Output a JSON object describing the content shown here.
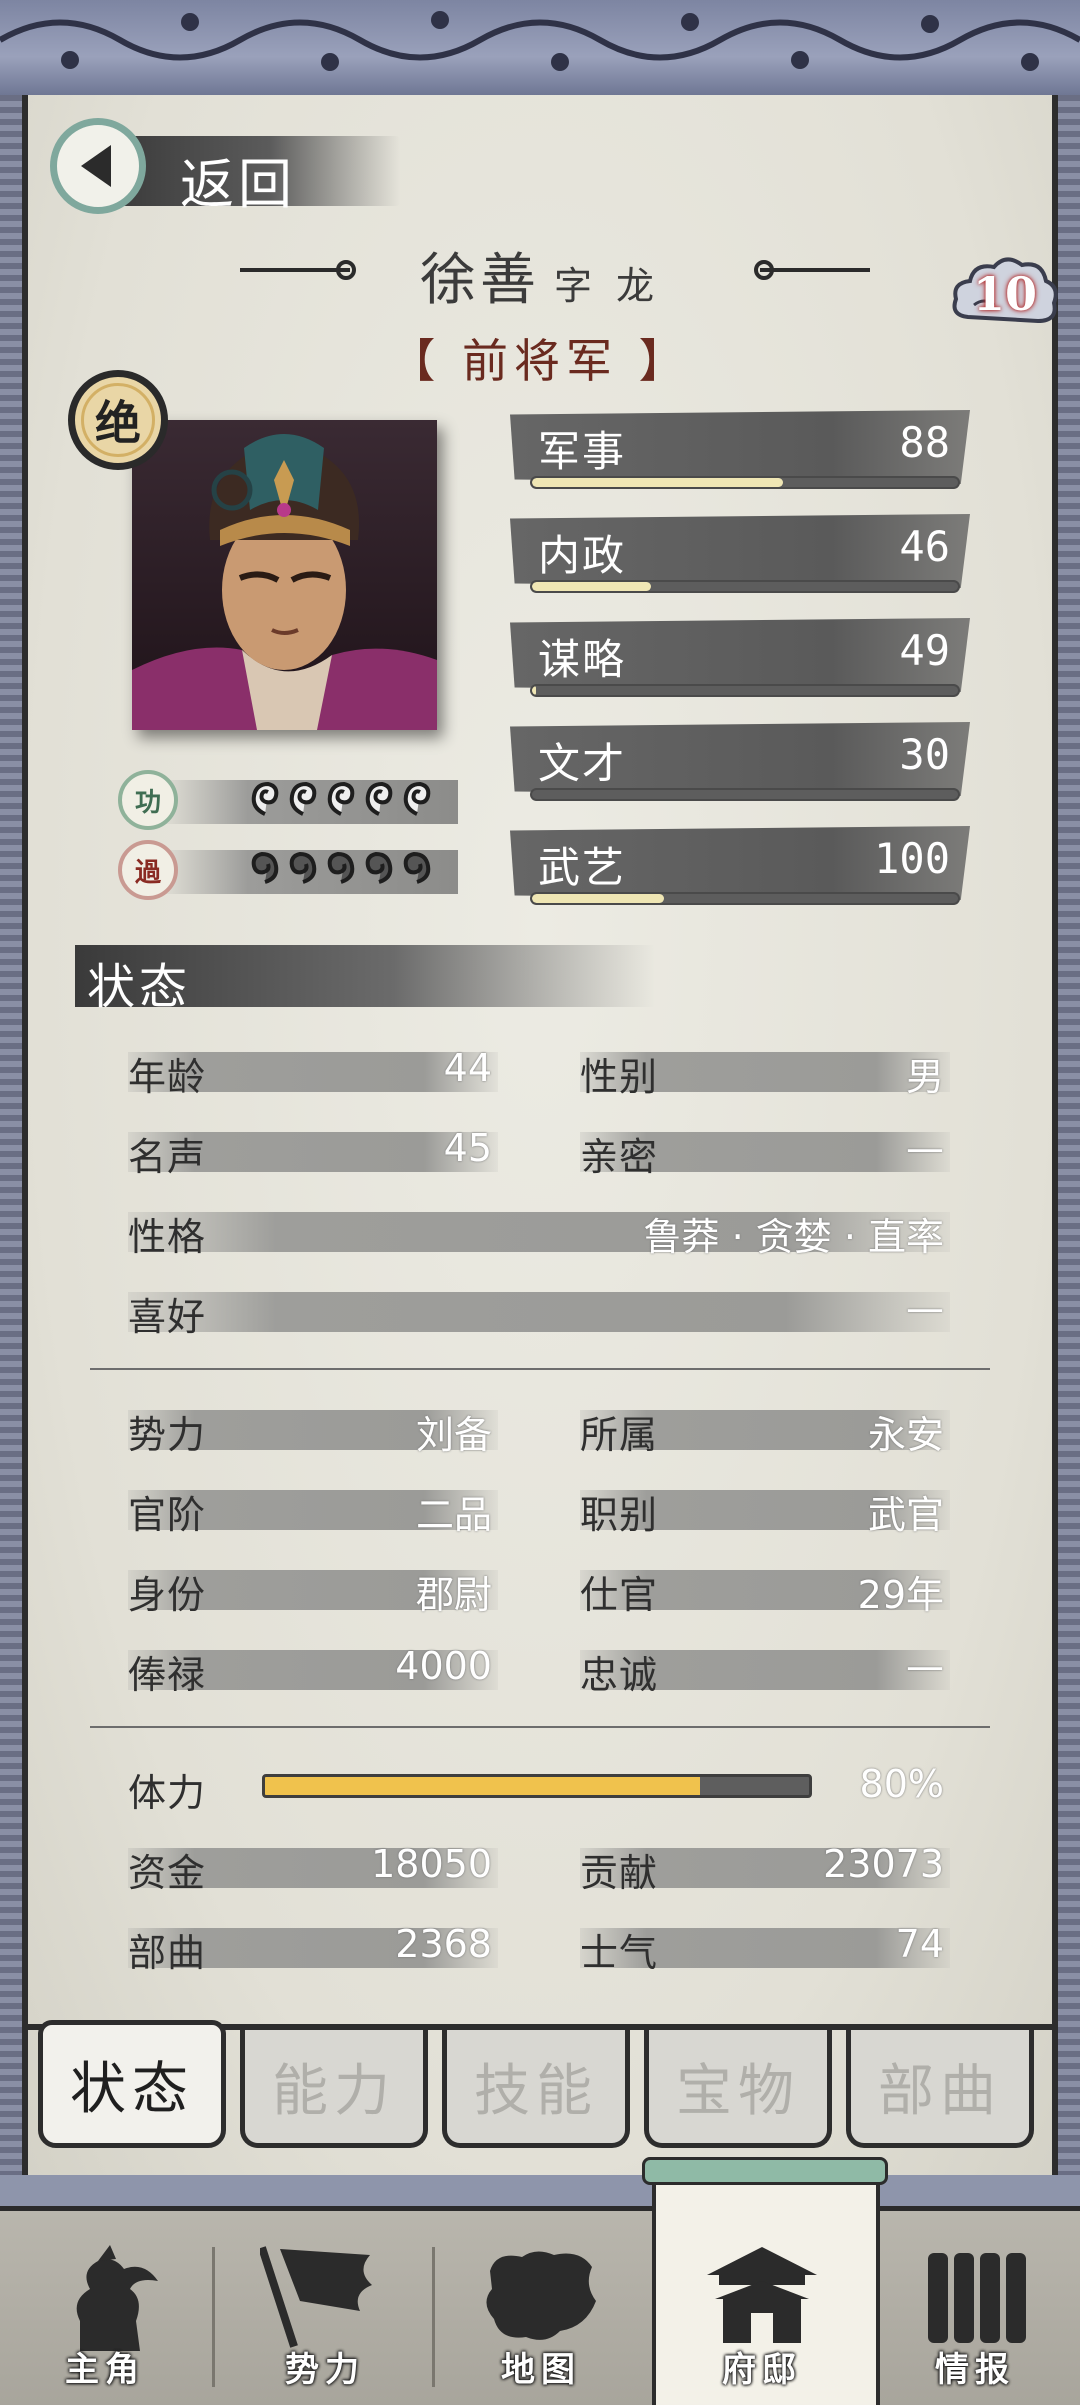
{
  "header": {
    "back_label": "返回",
    "name": "徐善",
    "courtesy_name": "字 龙",
    "title": "【 前将军 】",
    "level_badge": "10",
    "rank_badge": "绝"
  },
  "merits": {
    "merit_icon_label": "功",
    "fault_icon_label": "過",
    "merit_count": 5,
    "fault_count": 5
  },
  "attributes": [
    {
      "label": "军事",
      "value": "88",
      "fraction": 0.59
    },
    {
      "label": "内政",
      "value": "46",
      "fraction": 0.28
    },
    {
      "label": "谋略",
      "value": "49",
      "fraction": 0.01
    },
    {
      "label": "文才",
      "value": "30",
      "fraction": 0.0
    },
    {
      "label": "武艺",
      "value": "100",
      "fraction": 0.31
    }
  ],
  "status": {
    "header": "状态",
    "age_label": "年龄",
    "age": "44",
    "gender_label": "性别",
    "gender": "男",
    "fame_label": "名声",
    "fame": "45",
    "intimacy_label": "亲密",
    "intimacy": "—",
    "personality_label": "性格",
    "personality": "鲁莽 · 贪婪 · 直率",
    "hobby_label": "喜好",
    "hobby": "—",
    "faction_label": "势力",
    "faction": "刘备",
    "affiliation_label": "所属",
    "affiliation": "永安",
    "rank_label": "官阶",
    "rank": "二品",
    "post_type_label": "职别",
    "post_type": "武官",
    "identity_label": "身份",
    "identity": "郡尉",
    "service_label": "仕官",
    "service": "29年",
    "salary_label": "俸禄",
    "salary": "4000",
    "loyalty_label": "忠诚",
    "loyalty": "—",
    "stamina_label": "体力",
    "stamina": "80%",
    "stamina_fraction": 0.8,
    "funds_label": "资金",
    "funds": "18050",
    "contribution_label": "贡献",
    "contribution": "23073",
    "troops_label": "部曲",
    "troops": "2368",
    "morale_label": "士气",
    "morale": "74"
  },
  "tabs": [
    {
      "label": "状态",
      "active": true
    },
    {
      "label": "能力",
      "active": false
    },
    {
      "label": "技能",
      "active": false
    },
    {
      "label": "宝物",
      "active": false
    },
    {
      "label": "部曲",
      "active": false
    }
  ],
  "nav": [
    {
      "label": "主角",
      "icon": "warrior-icon"
    },
    {
      "label": "势力",
      "icon": "flag-icon"
    },
    {
      "label": "地图",
      "icon": "map-icon"
    },
    {
      "label": "府邸",
      "icon": "mansion-icon",
      "active": true
    },
    {
      "label": "情报",
      "icon": "scroll-icon"
    }
  ],
  "colors": {
    "stamina_fill": "#f0c24d",
    "attr_fill": "#efe6b4",
    "title_red": "#6a2a1f",
    "frame_blue": "#8e95ab"
  }
}
